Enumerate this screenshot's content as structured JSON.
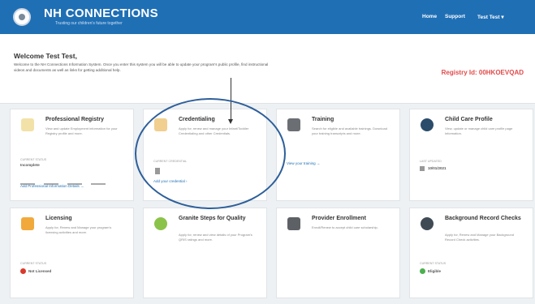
{
  "header": {
    "brand": "NH CONNECTIONS",
    "subtitle": "Trusting our children's future together",
    "nav": {
      "home": "Home",
      "support": "Support",
      "user": "Test Test ▾"
    }
  },
  "welcome": {
    "title": "Welcome Test Test,",
    "description": "Welcome to the NH Connections Information System. Once you enter this system you will be able to update your program's public profile, find instructional videos and documents as well as links for getting additional help.",
    "registry": "Registry Id: 00HKOEVQAD"
  },
  "cards": [
    {
      "title": "Professional Registry",
      "desc": "View and update Employment information for your Registry profile and more.",
      "status_label": "Current Status",
      "status": "Incomplete",
      "link": "Add Professional Information Details  →"
    },
    {
      "title": "Credentialing",
      "desc": "Apply for, renew and manage your Infant/Toddler Credentialing and other Credentials.",
      "status_label": "Current Credential",
      "link": "Add your credential  ›"
    },
    {
      "title": "Training",
      "desc": "Search for eligible and available trainings. Download your training transcripts and more.",
      "link": "View your training  →"
    },
    {
      "title": "Child Care Profile",
      "desc": "View, update or manage child care profile page information.",
      "status_label": "Last Updated",
      "status": "10/01/2021"
    },
    {
      "title": "Licensing",
      "desc": "Apply for, Renew and Manage your program's licensing activities and more.",
      "status_label": "Current Status",
      "status": "Not Licensed"
    },
    {
      "title": "Granite Steps for Quality",
      "desc": "Apply for, renew and view details of your Program's QRIS ratings and more."
    },
    {
      "title": "Provider Enrollment",
      "desc": "Enroll/Renew to accept child care scholarship."
    },
    {
      "title": "Background Record Checks",
      "desc": "Apply for, Renew and Manage your Background Record Check activities.",
      "status_label": "Current Status",
      "status": "Eligible"
    }
  ],
  "colors": {
    "header_bg": "#1f6fb5",
    "registry": "#e24a4a",
    "annotation": "#2d5f9a"
  }
}
